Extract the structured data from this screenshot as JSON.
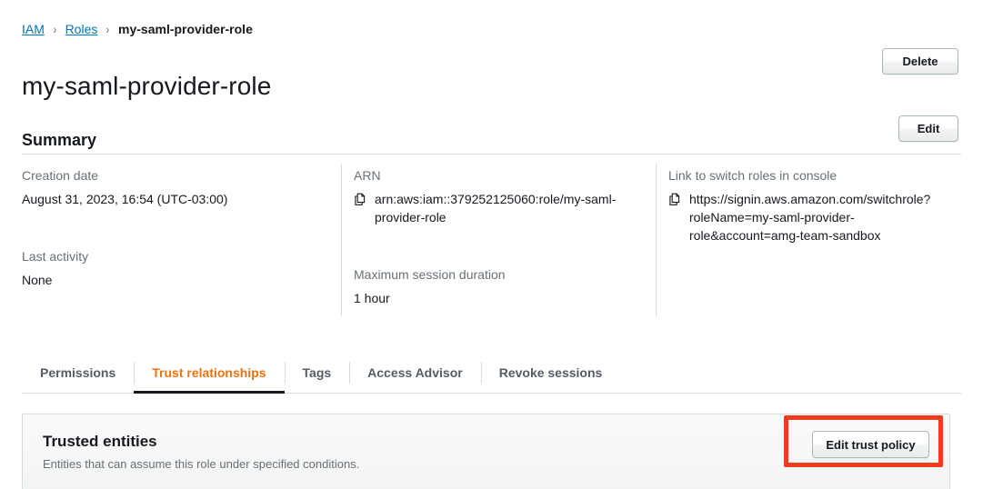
{
  "breadcrumb": {
    "items": [
      {
        "label": "IAM",
        "type": "link"
      },
      {
        "label": "Roles",
        "type": "link"
      },
      {
        "label": "my-saml-provider-role",
        "type": "current"
      }
    ],
    "separator": "›"
  },
  "header": {
    "title": "my-saml-provider-role",
    "delete_label": "Delete"
  },
  "summary": {
    "title": "Summary",
    "edit_label": "Edit",
    "columns": [
      {
        "fields": [
          {
            "label": "Creation date",
            "value": "August 31, 2023, 16:54 (UTC-03:00)",
            "copyable": false
          },
          {
            "label": "Last activity",
            "value": "None",
            "copyable": false
          }
        ]
      },
      {
        "fields": [
          {
            "label": "ARN",
            "value": "arn:aws:iam::379252125060:role/my-saml-provider-role",
            "copyable": true
          },
          {
            "label": "Maximum session duration",
            "value": "1 hour",
            "copyable": false
          }
        ]
      },
      {
        "fields": [
          {
            "label": "Link to switch roles in console",
            "value": "https://signin.aws.amazon.com/switchrole?roleName=my-saml-provider-role&account=amg-team-sandbox",
            "copyable": true
          }
        ]
      }
    ]
  },
  "tabs": [
    {
      "label": "Permissions",
      "active": false
    },
    {
      "label": "Trust relationships",
      "active": true
    },
    {
      "label": "Tags",
      "active": false
    },
    {
      "label": "Access Advisor",
      "active": false
    },
    {
      "label": "Revoke sessions",
      "active": false
    }
  ],
  "trusted_entities": {
    "heading": "Trusted entities",
    "description": "Entities that can assume this role under specified conditions.",
    "edit_trust_policy_label": "Edit trust policy"
  },
  "colors": {
    "link": "#0073bb",
    "active_tab": "#ec7211",
    "active_tab_underline": "#16191f",
    "text": "#16191f",
    "muted_text": "#687078",
    "border": "#d5dbdb",
    "highlight": "#ef3b1e",
    "panel_header_bg": "#f7f7f7"
  },
  "annotation": {
    "highlight_target": "edit-trust-policy-button"
  }
}
